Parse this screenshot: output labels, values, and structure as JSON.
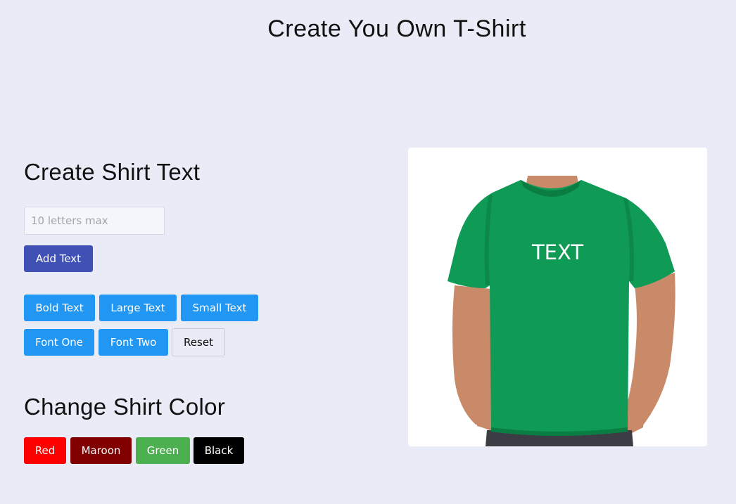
{
  "page": {
    "title": "Create You Own T-Shirt"
  },
  "text_section": {
    "heading": "Create Shirt Text",
    "input_placeholder": "10 letters max",
    "input_value": "",
    "add_button": "Add Text",
    "style_buttons": {
      "bold": "Bold Text",
      "large": "Large Text",
      "small": "Small Text",
      "font_one": "Font One",
      "font_two": "Font Two",
      "reset": "Reset"
    }
  },
  "color_section": {
    "heading": "Change Shirt Color",
    "buttons": [
      {
        "label": "Red",
        "color": "#ff0000"
      },
      {
        "label": "Maroon",
        "color": "#800000"
      },
      {
        "label": "Green",
        "color": "#4caf50"
      },
      {
        "label": "Black",
        "color": "#000000"
      }
    ]
  },
  "preview": {
    "shirt_text": "TEXT",
    "shirt_color": "#0f9a55",
    "shirt_color_shadow": "#0a7d43",
    "skin_color": "#c98a6a",
    "skin_shadow": "#a86a4e",
    "pants_color": "#3c3c44"
  }
}
